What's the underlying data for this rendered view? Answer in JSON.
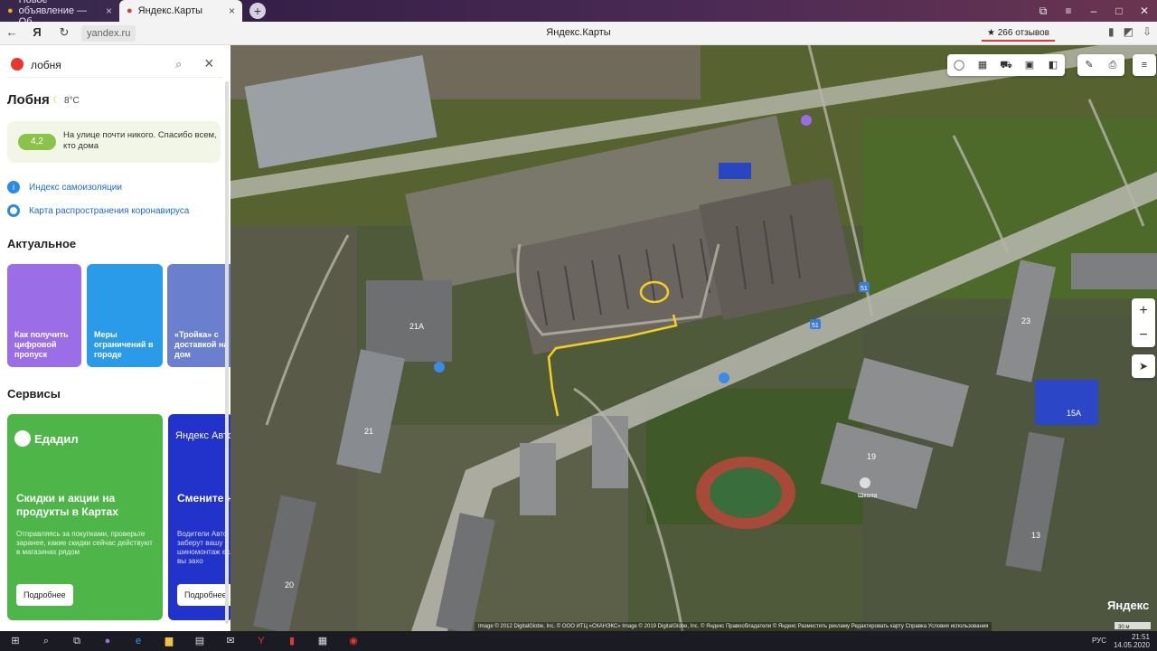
{
  "browser": {
    "tabs": [
      {
        "label": "Новое объявление — Об",
        "active": false
      },
      {
        "label": "Яндекс.Карты",
        "active": true
      }
    ],
    "url": "yandex.ru",
    "page_title": "Яндекс.Карты",
    "reviews": "★ 266 отзывов"
  },
  "sidebar": {
    "search_value": "лобня",
    "city": "Лобня",
    "weather": "8°C",
    "notice": {
      "badge": "4,2",
      "text": "На улице почти никого. Спасибо всем, кто дома"
    },
    "links": [
      "Индекс самоизоляции",
      "Карта распространения коронавируса"
    ],
    "section_actual": "Актуальное",
    "cards": [
      {
        "label": "Как получить цифровой пропуск",
        "color": "#9b6ee8"
      },
      {
        "label": "Меры ограничений в городе",
        "color": "#2a9be8"
      },
      {
        "label": "«Тройка» с доставкой на дом",
        "color": "#6b7fcf"
      }
    ],
    "section_services": "Сервисы",
    "services": [
      {
        "logo": "Едадил",
        "title": "Скидки и акции на продукты в Картах",
        "desc": "Отправляясь за покупками, проверьте заранее, какие скидки сейчас действуют в магазинах рядом",
        "button": "Подробнее"
      },
      {
        "logo": "Яндекс Авто",
        "title": "Смените не выход",
        "desc": "Водители Авто заберут вашу шиномонтаж если вы захо",
        "button": "Подробнее"
      }
    ]
  },
  "map": {
    "labels": {
      "b21a": "21А",
      "b19": "19",
      "b23": "23",
      "b15a": "15А",
      "b13": "13",
      "b21": "21",
      "b20": "20",
      "school": "Школа",
      "bus": "51"
    },
    "copyright": "Image © 2012 DigitalGlobe, Inc. © ООО ИТЦ «СКАНЭКС» Image © 2019 DigitalGlobe, Inc. © Яндекс  Правообладатели   © Яндекс  Разместить рекламу  Редактировать карту  Справка  Условия использования",
    "brand": "Яндекс",
    "scale": "30 м",
    "highlight_color": "#f2d21b"
  },
  "taskbar": {
    "time": "21:51",
    "date": "14.05.2020",
    "lang": "РУС"
  }
}
